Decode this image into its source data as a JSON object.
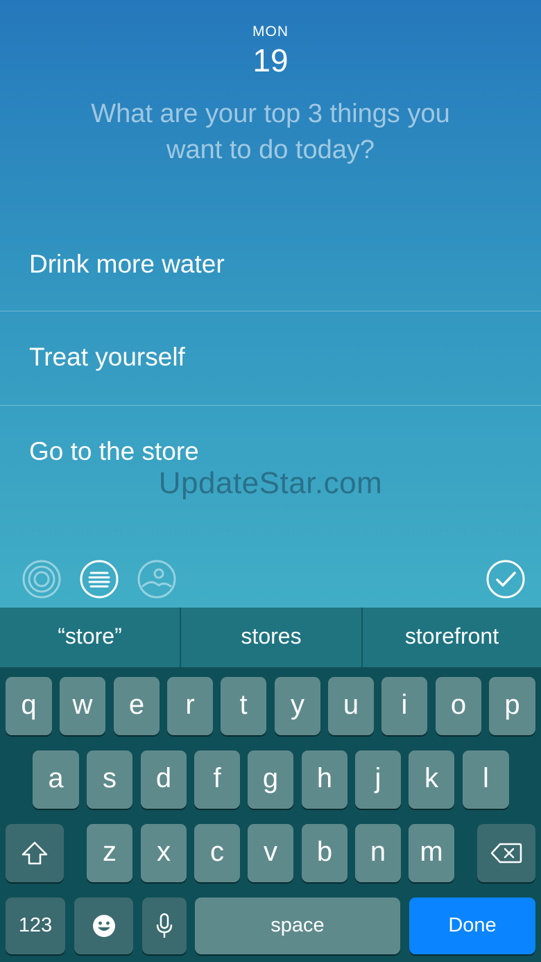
{
  "header": {
    "day": "MON",
    "date": "19"
  },
  "prompt": "What are your top 3 things you want to do today?",
  "tasks": [
    "Drink more water",
    "Treat yourself",
    "Go to the store"
  ],
  "watermark": "UpdateStar.com",
  "toolbar": {
    "icons": [
      "focus-rings-icon",
      "list-icon",
      "photo-icon",
      "check-circle-icon"
    ]
  },
  "suggestions": [
    "“store”",
    "stores",
    "storefront"
  ],
  "keyboard": {
    "row1": [
      "q",
      "w",
      "e",
      "r",
      "t",
      "y",
      "u",
      "i",
      "o",
      "p"
    ],
    "row2": [
      "a",
      "s",
      "d",
      "f",
      "g",
      "h",
      "j",
      "k",
      "l"
    ],
    "row3": [
      "z",
      "x",
      "c",
      "v",
      "b",
      "n",
      "m"
    ],
    "numbers_label": "123",
    "space_label": "space",
    "done_label": "Done",
    "colors": {
      "done": "#0a84ff",
      "key": "#5f8a8c",
      "special_key": "#3b6a6f"
    }
  }
}
